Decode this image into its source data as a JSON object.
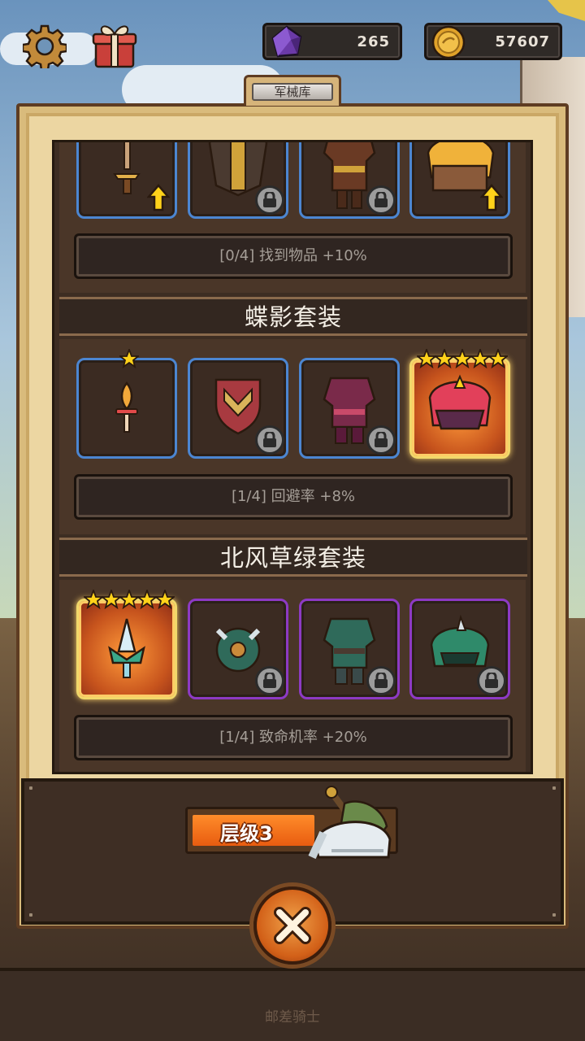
{
  "topbar": {
    "gems": "265",
    "coins": "57607",
    "icons": [
      "gear-icon",
      "gift-icon",
      "gem-icon",
      "coin-icon"
    ]
  },
  "panel": {
    "title": "军械库"
  },
  "sets": [
    {
      "name": "",
      "bonus": "[0/4] 找到物品 +10%",
      "items": [
        {
          "icon": "sword-icon",
          "state": "upgrade"
        },
        {
          "icon": "shield-icon",
          "state": "locked"
        },
        {
          "icon": "armor-icon",
          "state": "locked"
        },
        {
          "icon": "helmet-icon",
          "state": "upgrade"
        }
      ]
    },
    {
      "name": "蝶影套装",
      "bonus": "[1/4] 回避率 +8%",
      "items": [
        {
          "icon": "dagger-icon",
          "stars": 1,
          "state": "owned"
        },
        {
          "icon": "shield-icon",
          "state": "locked"
        },
        {
          "icon": "armor-icon",
          "state": "locked"
        },
        {
          "icon": "helmet-icon",
          "stars": 5,
          "state": "legendary"
        }
      ]
    },
    {
      "name": "北风草绿套装",
      "bonus": "[1/4] 致命机率 +20%",
      "items": [
        {
          "icon": "crystal-blade-icon",
          "stars": 5,
          "state": "legendary"
        },
        {
          "icon": "shield-icon",
          "state": "locked"
        },
        {
          "icon": "armor-icon",
          "state": "locked"
        },
        {
          "icon": "helmet-icon",
          "state": "locked"
        }
      ]
    }
  ],
  "bottom": {
    "tier_label": "层级3",
    "tier_progress": 0.6,
    "close_icon": "close-icon"
  },
  "footer": {
    "caption": "邮差骑士"
  },
  "colors": {
    "rare_border": "#4c86d1",
    "epic_border": "#8d3ac4",
    "legendary_border": "#f1d86a",
    "accent_orange": "#e85c10"
  }
}
